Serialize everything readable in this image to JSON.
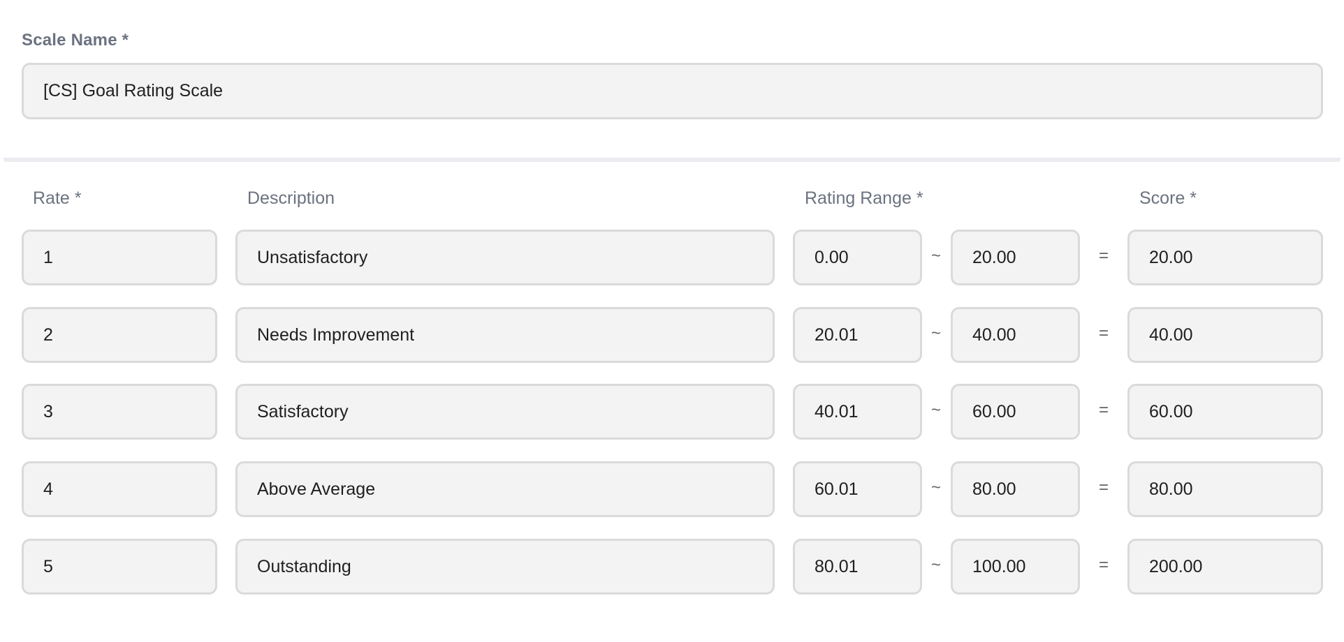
{
  "scale_name": {
    "label": "Scale Name *",
    "value": "[CS] Goal Rating Scale"
  },
  "columns": {
    "rate": "Rate *",
    "description": "Description",
    "rating_range": "Rating Range *",
    "score": "Score *"
  },
  "separators": {
    "range": "~",
    "equals": "="
  },
  "rows": [
    {
      "rate": "1",
      "description": "Unsatisfactory",
      "range_from": "0.00",
      "range_to": "20.00",
      "score": "20.00"
    },
    {
      "rate": "2",
      "description": "Needs Improvement",
      "range_from": "20.01",
      "range_to": "40.00",
      "score": "40.00"
    },
    {
      "rate": "3",
      "description": "Satisfactory",
      "range_from": "40.01",
      "range_to": "60.00",
      "score": "60.00"
    },
    {
      "rate": "4",
      "description": "Above Average",
      "range_from": "60.01",
      "range_to": "80.00",
      "score": "80.00"
    },
    {
      "rate": "5",
      "description": "Outstanding",
      "range_from": "80.01",
      "range_to": "100.00",
      "score": "200.00"
    }
  ]
}
